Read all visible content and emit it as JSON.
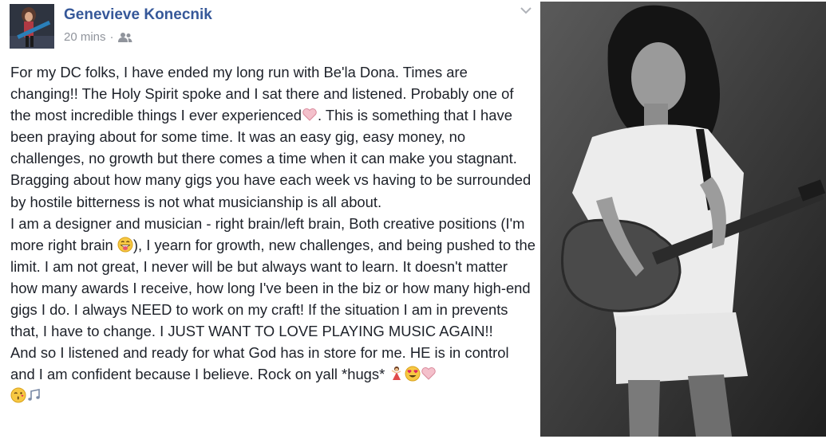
{
  "post": {
    "author": "Genevieve Konecnik",
    "time": "20 mins",
    "separator": "·",
    "icons": {
      "audience": "friends-audience-icon",
      "options": "chevron-down-icon"
    },
    "paragraphs": [
      "For my DC folks, I have ended my long run with Be'la Dona. Times are changing!! The Holy Spirit spoke and I sat there and listened. Probably one of the most incredible things I ever experienced",
      ". This is something that I have been praying about for some time. It was an easy gig, easy money, no challenges, no growth but there comes a time when it can make you stagnant. Bragging about how many gigs you have each week vs having to be surrounded by hostile bitterness is not what musicianship is all about.",
      "I am a designer and musician - right brain/left brain, Both creative positions (I'm more right brain ",
      "), I yearn for growth, new challenges, and being pushed to the limit. I am not great, I never will be but always want to learn. It doesn't matter how many awards I receive, how long I've been in the biz or how many high-end gigs I do. I always NEED to work on my craft! If the situation I am in prevents that, I have to change. I JUST WANT TO LOVE PLAYING MUSIC AGAIN!!",
      "And so I listened and ready for what God has in store for me. HE is in control and I am confident because I believe. Rock on yall *hugs* "
    ],
    "emoji": {
      "heart": "pink-heart-icon",
      "grin": "grinning-tongue-icon",
      "dancer": "dancer-icon",
      "heart_eyes": "heart-eyes-icon",
      "kiss": "kissing-icon",
      "notes": "music-notes-icon"
    },
    "colors": {
      "author": "#365899",
      "meta": "#90949c",
      "text": "#1d2129",
      "heart": "#f4a6b7"
    }
  }
}
